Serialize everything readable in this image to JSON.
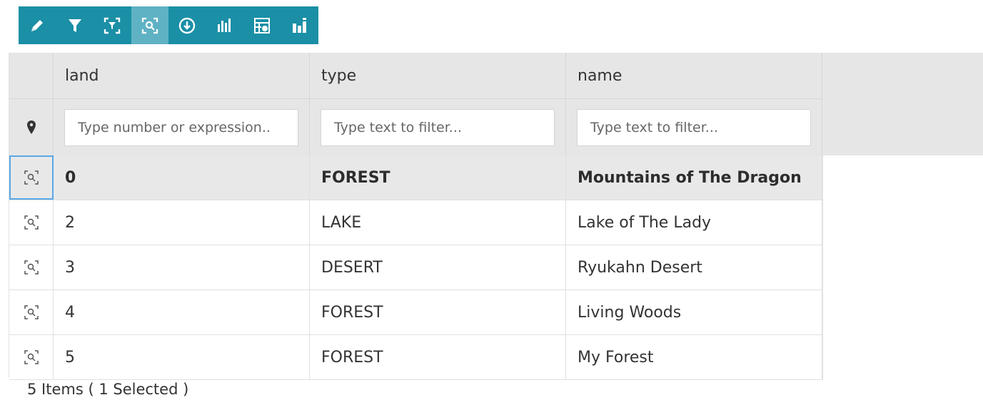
{
  "toolbar": {
    "buttons": [
      {
        "icon": "pencil-icon",
        "active": false
      },
      {
        "icon": "filter-icon",
        "active": false
      },
      {
        "icon": "filter-selection-icon",
        "active": false
      },
      {
        "icon": "zoom-to-selection-icon",
        "active": true
      },
      {
        "icon": "download-icon",
        "active": false
      },
      {
        "icon": "chart-icon",
        "active": false
      },
      {
        "icon": "table-settings-icon",
        "active": false
      },
      {
        "icon": "widget-chart-icon",
        "active": false
      }
    ],
    "color": "#1a8fa6",
    "active_color": "#5fb2c4"
  },
  "columns": [
    {
      "key": "land",
      "label": "land",
      "filter_placeholder": "Type number or expression.."
    },
    {
      "key": "type",
      "label": "type",
      "filter_placeholder": "Type text to filter..."
    },
    {
      "key": "name",
      "label": "name",
      "filter_placeholder": "Type text to filter..."
    }
  ],
  "filter_row_icon": "map-marker-icon",
  "rows": [
    {
      "land": "0",
      "type": "FOREST",
      "name": "Mountains of The Dragon",
      "selected": true
    },
    {
      "land": "2",
      "type": "LAKE",
      "name": "Lake of The Lady",
      "selected": false
    },
    {
      "land": "3",
      "type": "DESERT",
      "name": "Ryukahn Desert",
      "selected": false
    },
    {
      "land": "4",
      "type": "FOREST",
      "name": "Living Woods",
      "selected": false
    },
    {
      "land": "5",
      "type": "FOREST",
      "name": "My Forest",
      "selected": false
    }
  ],
  "footer": {
    "summary": "5 Items ( 1 Selected )"
  }
}
